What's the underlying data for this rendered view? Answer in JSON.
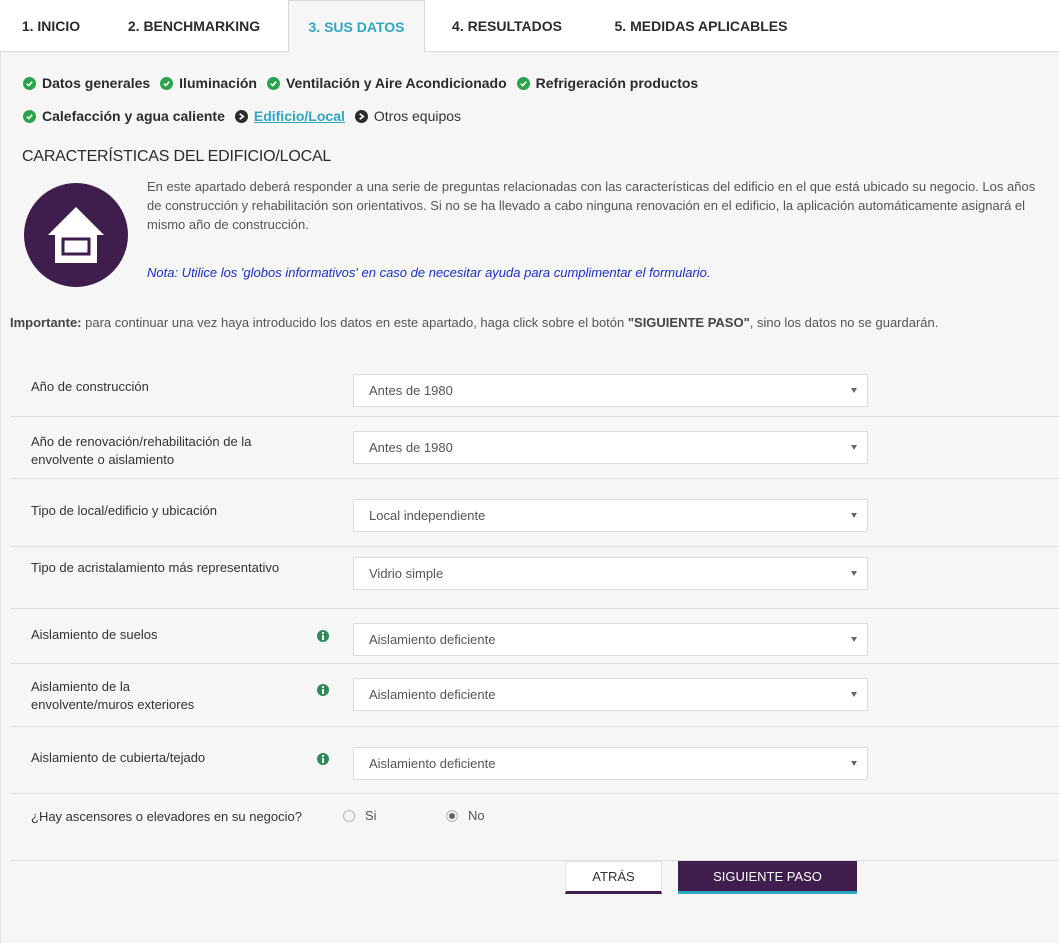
{
  "tabs": [
    {
      "label": "1. INICIO"
    },
    {
      "label": "2. BENCHMARKING"
    },
    {
      "label": "3. SUS DATOS"
    },
    {
      "label": "4. RESULTADOS"
    },
    {
      "label": "5. MEDIDAS APLICABLES"
    }
  ],
  "active_tab": "3. SUS DATOS",
  "steps": [
    {
      "label": "Datos generales",
      "status": "done"
    },
    {
      "label": "Iluminación",
      "status": "done"
    },
    {
      "label": "Ventilación y Aire Acondicionado",
      "status": "done"
    },
    {
      "label": "Refrigeración productos",
      "status": "done"
    },
    {
      "label": "Calefacción y agua caliente",
      "status": "done"
    },
    {
      "label": "Edificio/Local",
      "status": "current"
    },
    {
      "label": "Otros equipos",
      "status": "pending"
    }
  ],
  "section": {
    "title": "CARACTERÍSTICAS DEL EDIFICIO/LOCAL",
    "intro": "En este apartado deberá responder a una serie de preguntas relacionadas con las características del edificio en el que está ubicado su negocio. Los años de construcción y rehabilitación son orientativos. Si no se ha llevado a cabo ninguna renovación en el edificio, la aplicación automáticamente asignará el mismo año de construcción.",
    "note": "Nota: Utilice los 'globos informativos' en caso de necesitar ayuda para cumplimentar el formulario.",
    "important_label": "Importante:",
    "important_text_1": " para continuar una vez haya introducido los datos en este apartado, haga click sobre el botón ",
    "important_button_ref": "\"SIGUIENTE PASO\"",
    "important_text_2": ", sino los datos no se guardarán."
  },
  "fields": [
    {
      "label": "Año de construcción",
      "value": "Antes de 1980",
      "info": false
    },
    {
      "label": "Año de renovación/rehabilitación de la envolvente o aislamiento",
      "value": "Antes de 1980",
      "info": false
    },
    {
      "label": "Tipo de local/edificio y ubicación",
      "value": "Local independiente",
      "info": false
    },
    {
      "label": "Tipo de acristalamiento más representativo",
      "value": "Vidrio simple",
      "info": false
    },
    {
      "label": "Aislamiento de suelos",
      "value": "Aislamiento deficiente",
      "info": true
    },
    {
      "label": "Aislamiento de la envolvente/muros exteriores",
      "value": "Aislamiento deficiente",
      "info": true
    },
    {
      "label": "Aislamiento de cubierta/tejado",
      "value": "Aislamiento deficiente",
      "info": true
    }
  ],
  "elevator": {
    "label": "¿Hay ascensores o elevadores en su negocio?",
    "options": [
      "Si",
      "No"
    ],
    "selected": "No"
  },
  "buttons": {
    "back": "ATRÁS",
    "next": "SIGUIENTE PASO"
  },
  "colors": {
    "accent": "#2ea7c5",
    "brand": "#3f1e4e",
    "check": "#2aa44a",
    "note": "#1a2fc9"
  }
}
